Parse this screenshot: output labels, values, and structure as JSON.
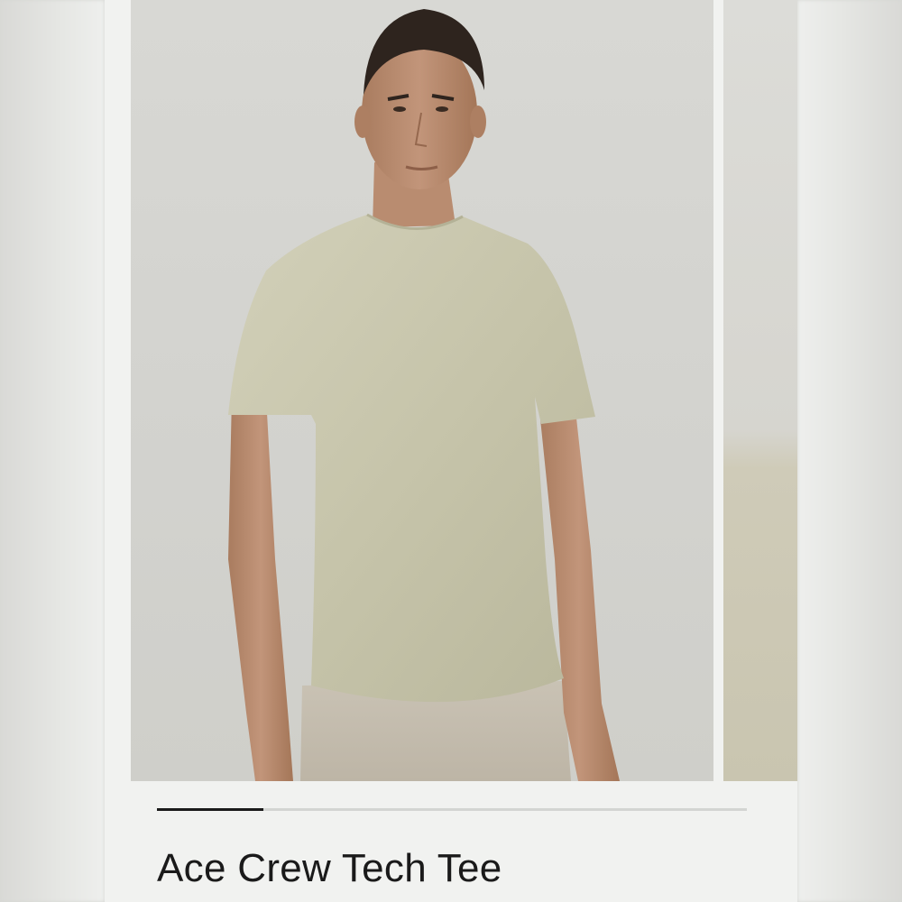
{
  "product": {
    "title": "Ace Crew Tech Tee",
    "image_alt": "Model wearing sage crew neck tee"
  },
  "carousel": {
    "progress": 0.18,
    "slide_count_visible": 2
  },
  "colors": {
    "tee": "#c9c7ad",
    "backdrop": "#d5d5d1",
    "accent": "#1a1a1a"
  }
}
